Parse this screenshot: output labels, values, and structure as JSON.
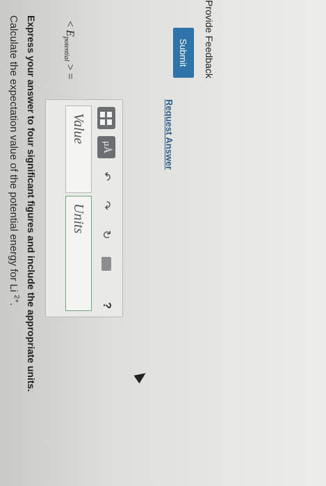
{
  "question": {
    "prompt": "Calculate the expectation value of the potential energy for Li",
    "prompt_ion": "2+",
    "prompt_end": ".",
    "instruction": "Express your answer to four significant figures and include the appropriate units."
  },
  "equation": {
    "lhs_open": "< ",
    "symbol": "E",
    "subscript": "potential",
    "lhs_close": " > ="
  },
  "toolbar": {
    "mu_label": "μÅ",
    "undo_glyph": "↶",
    "redo_glyph": "↷",
    "reset_glyph": "↻",
    "help_label": "?"
  },
  "inputs": {
    "value_placeholder": "Value",
    "units_placeholder": "Units"
  },
  "actions": {
    "submit_label": "Submit",
    "request_answer_label": "Request Answer",
    "feedback_label": "Provide Feedback"
  },
  "colors": {
    "submit_bg": "#2f74a9",
    "link": "#2d5d8c",
    "units_border": "#6aa77d"
  }
}
